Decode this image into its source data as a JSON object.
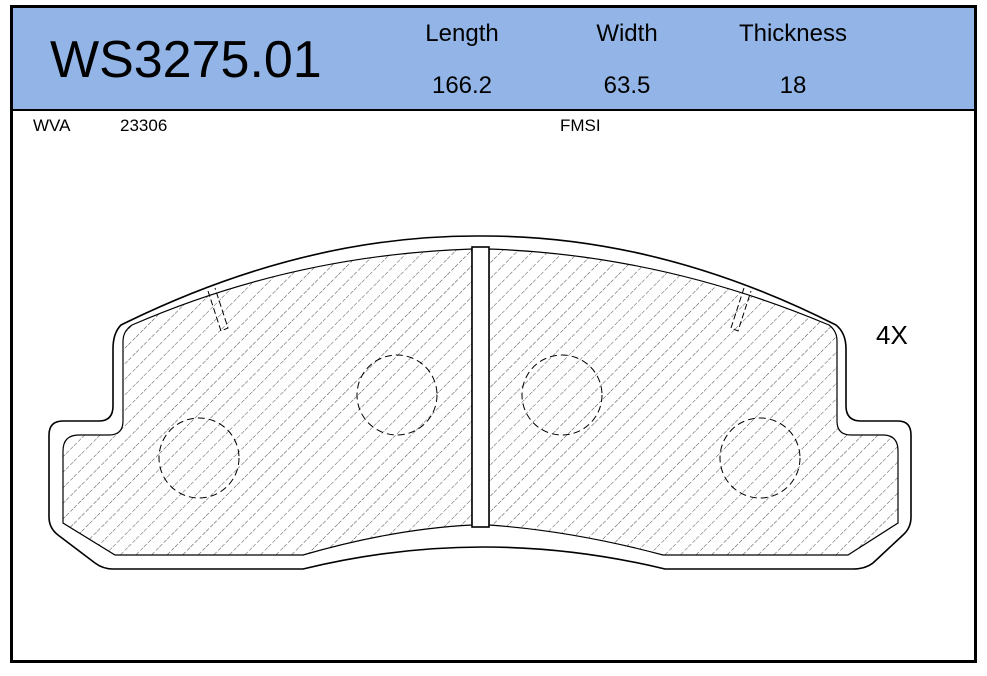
{
  "header": {
    "part_number": "WS3275.01",
    "columns": [
      {
        "label": "Length",
        "value": "166.2"
      },
      {
        "label": "Width",
        "value": "63.5"
      },
      {
        "label": "Thickness",
        "value": "18"
      }
    ],
    "background_color": "#92b4e6"
  },
  "meta": {
    "wva_label": "WVA",
    "wva_value": "23306",
    "fmsi_label": "FMSI"
  },
  "quantity": "4X",
  "drawing": {
    "icon": "brake-pad-outline"
  }
}
